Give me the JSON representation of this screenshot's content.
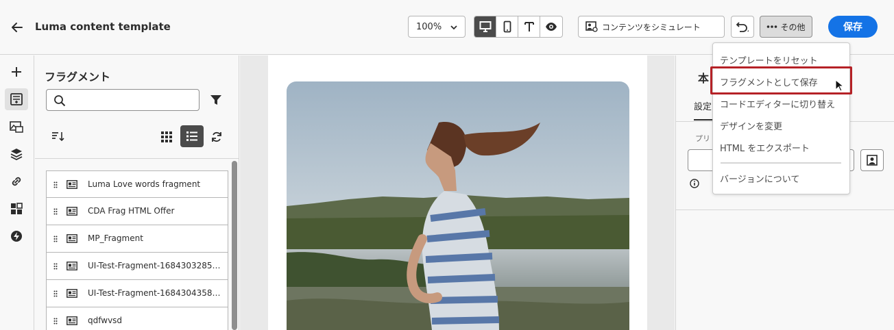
{
  "header": {
    "title": "Luma content template",
    "zoom": "100%",
    "simulate_label": "コンテンツをシミュレート",
    "more_label": "その他",
    "save_label": "保存"
  },
  "left_rail": {
    "items": [
      "add-icon",
      "fragments-icon",
      "assets-icon",
      "layers-icon",
      "link-icon",
      "components-icon",
      "dynamic-icon"
    ],
    "active_index": 1
  },
  "fragments_panel": {
    "title": "フラグメント",
    "search_placeholder": "",
    "items": [
      "Luma Love words fragment",
      "CDA Frag HTML Offer",
      "MP_Fragment",
      "UI-Test-Fragment-168430328546...",
      "UI-Test-Fragment-168430435899...",
      "qdfwvsd"
    ]
  },
  "right_panel": {
    "title": "本",
    "tab": "設定",
    "field_label": "プリ"
  },
  "menu": {
    "items": [
      "テンプレートをリセット",
      "フラグメントとして保存",
      "コードエディターに切り替え",
      "デザインを変更",
      "HTML をエクスポート",
      "バージョンについて"
    ],
    "highlighted_index": 1
  },
  "colors": {
    "accent": "#1473e6",
    "highlight_box": "#b52126",
    "active_toggle": "#4b4b4b"
  }
}
